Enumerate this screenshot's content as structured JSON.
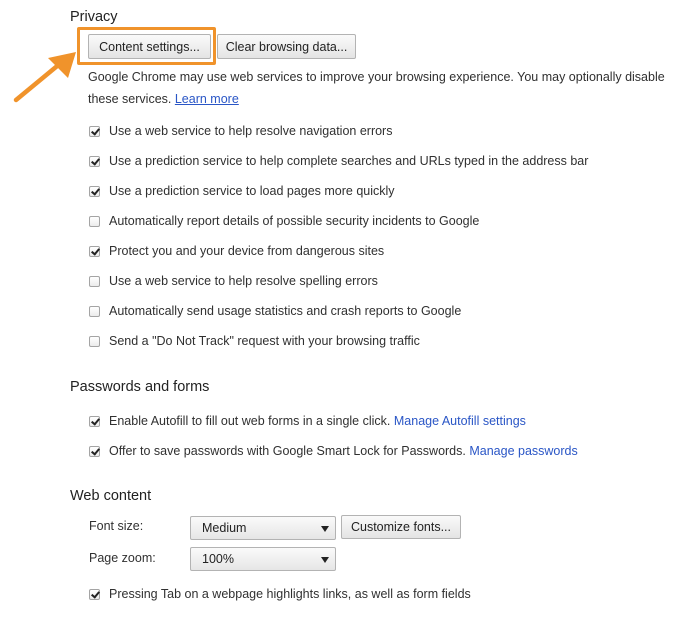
{
  "privacy": {
    "title": "Privacy",
    "content_settings_label": "Content settings...",
    "clear_browsing_label": "Clear browsing data...",
    "description": "Google Chrome may use web services to improve your browsing experience. You may optionally disable these services.",
    "learn_more": "Learn more",
    "options": [
      {
        "label": "Use a web service to help resolve navigation errors",
        "checked": true
      },
      {
        "label": "Use a prediction service to help complete searches and URLs typed in the address bar",
        "checked": true
      },
      {
        "label": "Use a prediction service to load pages more quickly",
        "checked": true
      },
      {
        "label": "Automatically report details of possible security incidents to Google",
        "checked": false
      },
      {
        "label": "Protect you and your device from dangerous sites",
        "checked": true
      },
      {
        "label": "Use a web service to help resolve spelling errors",
        "checked": false
      },
      {
        "label": "Automatically send usage statistics and crash reports to Google",
        "checked": false
      },
      {
        "label": "Send a \"Do Not Track\" request with your browsing traffic",
        "checked": false
      }
    ]
  },
  "passwords": {
    "title": "Passwords and forms",
    "autofill_label": "Enable Autofill to fill out web forms in a single click.",
    "autofill_link": "Manage Autofill settings",
    "autofill_checked": true,
    "save_label": "Offer to save passwords with Google Smart Lock for Passwords.",
    "save_link": "Manage passwords",
    "save_checked": true
  },
  "web_content": {
    "title": "Web content",
    "font_size_label": "Font size:",
    "font_size_value": "Medium",
    "customize_fonts_label": "Customize fonts...",
    "page_zoom_label": "Page zoom:",
    "page_zoom_value": "100%",
    "tab_label": "Pressing Tab on a webpage highlights links, as well as form fields",
    "tab_checked": true
  },
  "colors": {
    "highlight": "#f0932b",
    "link": "#2a56c6"
  }
}
